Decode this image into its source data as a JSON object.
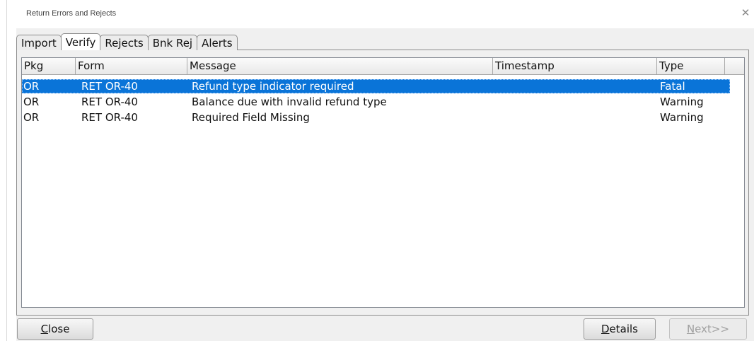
{
  "window": {
    "title": "Return Errors and Rejects",
    "close_glyph": "✕"
  },
  "tabs": [
    {
      "label": "Import",
      "active": false
    },
    {
      "label": "Verify",
      "active": true
    },
    {
      "label": "Rejects",
      "active": false
    },
    {
      "label": "Bnk Rej",
      "active": false
    },
    {
      "label": "Alerts",
      "active": false
    }
  ],
  "table": {
    "columns": [
      "Pkg",
      "Form",
      "Message",
      "Timestamp",
      "Type"
    ],
    "rows": [
      {
        "pkg": "OR",
        "form": "RET OR-40",
        "message": "Refund type indicator required",
        "timestamp": "",
        "type": "Fatal",
        "selected": true
      },
      {
        "pkg": "OR",
        "form": "RET OR-40",
        "message": "Balance due with invalid refund type",
        "timestamp": "",
        "type": "Warning",
        "selected": false
      },
      {
        "pkg": "OR",
        "form": "RET OR-40",
        "message": "Required Field Missing",
        "timestamp": "",
        "type": "Warning",
        "selected": false
      }
    ]
  },
  "buttons": {
    "close": {
      "mnemonic": "C",
      "rest": "lose"
    },
    "details": {
      "mnemonic": "D",
      "rest": "etails"
    },
    "next": {
      "mnemonic": "N",
      "rest": "ext>>",
      "enabled": false
    }
  },
  "colors": {
    "selection": "#0a74d8",
    "background": "#f0f0f0"
  }
}
